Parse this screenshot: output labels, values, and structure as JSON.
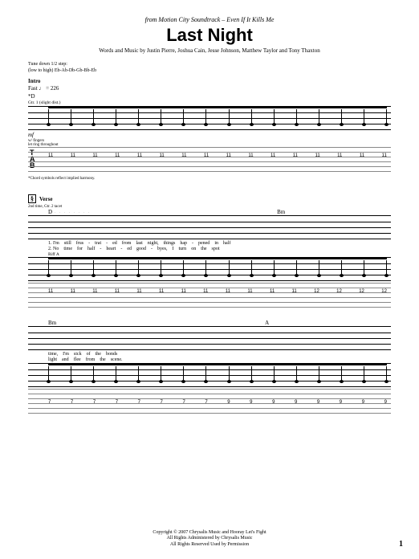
{
  "header": {
    "from_prefix": "from Motion City Soundtrack –",
    "album": "Even If It Kills Me",
    "title": "Last Night",
    "credits": "Words and Music by Justin Pierre, Joshua Cain, Jesse Johnson, Matthew Taylor and Tony Thaxton"
  },
  "tuning": {
    "line1": "Tune down 1/2 step:",
    "line2": "(low to high) Eb-Ab-Db-Gb-Bb-Eb"
  },
  "intro": {
    "label": "Intro",
    "tempo": "Fast ♩ = 226",
    "chord": "*D",
    "gtr": "Gtr. 1 (slight dist.)",
    "dynamic": "mf",
    "technique": "w/ fingers",
    "technique2": "let ring throughout",
    "footnote": "*Chord symbols reflect implied harmony.",
    "tab_pattern": [
      "11",
      "11",
      "11",
      "11",
      "11",
      "11",
      "11",
      "11",
      "11",
      "11",
      "11",
      "11",
      "11",
      "11",
      "11",
      "11"
    ]
  },
  "verse": {
    "marker": "§",
    "label": "Verse",
    "note": "2nd time, Gtr. 2 tacet",
    "chord1": "D",
    "chord2": "Bm",
    "lyrics1": [
      "1. I'm",
      "still",
      "frus",
      "-",
      "trat",
      "-",
      "ed",
      "from",
      "last",
      "night,",
      "",
      "things",
      "hap",
      "-",
      "pened",
      "in",
      "half",
      "-"
    ],
    "lyrics2": [
      "2. No",
      "time",
      "for",
      "half",
      "-",
      "heart",
      "-",
      "ed",
      "good",
      "-",
      "byes,",
      "",
      "I",
      "turn",
      "on",
      "the",
      "spot",
      "-"
    ],
    "riff": "Riff A",
    "tab_pattern": [
      "11",
      "11",
      "11",
      "11",
      "11",
      "11",
      "11",
      "11",
      "11",
      "11",
      "11",
      "11",
      "12",
      "12",
      "12",
      "12"
    ]
  },
  "system3": {
    "chord1": "Bm",
    "chord2": "A",
    "lyrics1": [
      "time,",
      "",
      "I'm",
      "sick",
      "of",
      "the",
      "bonds",
      "",
      "",
      "",
      "",
      "",
      "",
      "",
      "",
      ""
    ],
    "lyrics2": [
      "light",
      "",
      "and",
      "flee",
      "from",
      "the",
      "scene.",
      "",
      "",
      "",
      "",
      "",
      "",
      "",
      "",
      ""
    ],
    "tab_pattern": [
      "7",
      "7",
      "7",
      "7",
      "7",
      "7",
      "7",
      "7",
      "9",
      "9",
      "9",
      "9",
      "9",
      "9",
      "9",
      "9"
    ]
  },
  "footer": {
    "line1": "Copyright © 2007 Chrysalis Music and Hooray Let's Fight",
    "line2": "All Rights Administered by Chrysalis Music",
    "line3": "All Rights Reserved   Used by Permission"
  },
  "page_number": "1"
}
